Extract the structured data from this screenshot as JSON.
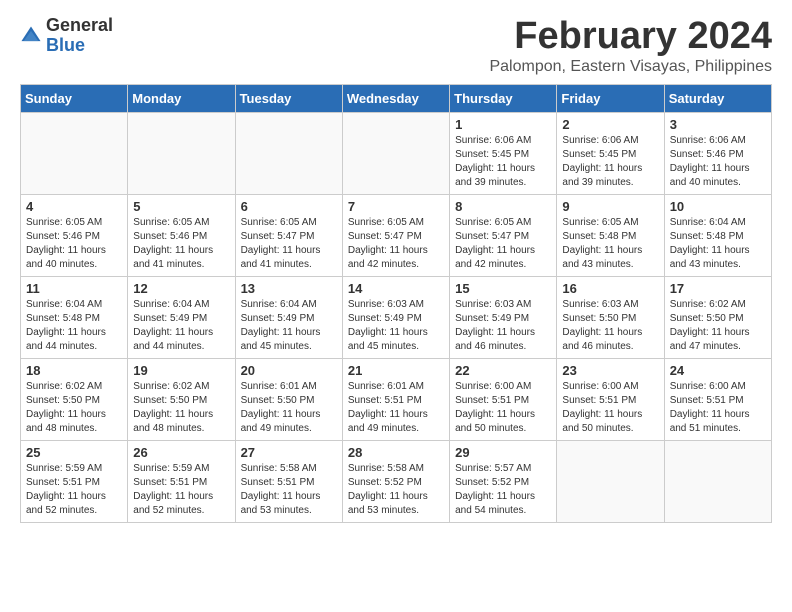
{
  "logo": {
    "general": "General",
    "blue": "Blue"
  },
  "header": {
    "month": "February 2024",
    "location": "Palompon, Eastern Visayas, Philippines"
  },
  "weekdays": [
    "Sunday",
    "Monday",
    "Tuesday",
    "Wednesday",
    "Thursday",
    "Friday",
    "Saturday"
  ],
  "weeks": [
    [
      {
        "day": "",
        "info": ""
      },
      {
        "day": "",
        "info": ""
      },
      {
        "day": "",
        "info": ""
      },
      {
        "day": "",
        "info": ""
      },
      {
        "day": "1",
        "info": "Sunrise: 6:06 AM\nSunset: 5:45 PM\nDaylight: 11 hours\nand 39 minutes."
      },
      {
        "day": "2",
        "info": "Sunrise: 6:06 AM\nSunset: 5:45 PM\nDaylight: 11 hours\nand 39 minutes."
      },
      {
        "day": "3",
        "info": "Sunrise: 6:06 AM\nSunset: 5:46 PM\nDaylight: 11 hours\nand 40 minutes."
      }
    ],
    [
      {
        "day": "4",
        "info": "Sunrise: 6:05 AM\nSunset: 5:46 PM\nDaylight: 11 hours\nand 40 minutes."
      },
      {
        "day": "5",
        "info": "Sunrise: 6:05 AM\nSunset: 5:46 PM\nDaylight: 11 hours\nand 41 minutes."
      },
      {
        "day": "6",
        "info": "Sunrise: 6:05 AM\nSunset: 5:47 PM\nDaylight: 11 hours\nand 41 minutes."
      },
      {
        "day": "7",
        "info": "Sunrise: 6:05 AM\nSunset: 5:47 PM\nDaylight: 11 hours\nand 42 minutes."
      },
      {
        "day": "8",
        "info": "Sunrise: 6:05 AM\nSunset: 5:47 PM\nDaylight: 11 hours\nand 42 minutes."
      },
      {
        "day": "9",
        "info": "Sunrise: 6:05 AM\nSunset: 5:48 PM\nDaylight: 11 hours\nand 43 minutes."
      },
      {
        "day": "10",
        "info": "Sunrise: 6:04 AM\nSunset: 5:48 PM\nDaylight: 11 hours\nand 43 minutes."
      }
    ],
    [
      {
        "day": "11",
        "info": "Sunrise: 6:04 AM\nSunset: 5:48 PM\nDaylight: 11 hours\nand 44 minutes."
      },
      {
        "day": "12",
        "info": "Sunrise: 6:04 AM\nSunset: 5:49 PM\nDaylight: 11 hours\nand 44 minutes."
      },
      {
        "day": "13",
        "info": "Sunrise: 6:04 AM\nSunset: 5:49 PM\nDaylight: 11 hours\nand 45 minutes."
      },
      {
        "day": "14",
        "info": "Sunrise: 6:03 AM\nSunset: 5:49 PM\nDaylight: 11 hours\nand 45 minutes."
      },
      {
        "day": "15",
        "info": "Sunrise: 6:03 AM\nSunset: 5:49 PM\nDaylight: 11 hours\nand 46 minutes."
      },
      {
        "day": "16",
        "info": "Sunrise: 6:03 AM\nSunset: 5:50 PM\nDaylight: 11 hours\nand 46 minutes."
      },
      {
        "day": "17",
        "info": "Sunrise: 6:02 AM\nSunset: 5:50 PM\nDaylight: 11 hours\nand 47 minutes."
      }
    ],
    [
      {
        "day": "18",
        "info": "Sunrise: 6:02 AM\nSunset: 5:50 PM\nDaylight: 11 hours\nand 48 minutes."
      },
      {
        "day": "19",
        "info": "Sunrise: 6:02 AM\nSunset: 5:50 PM\nDaylight: 11 hours\nand 48 minutes."
      },
      {
        "day": "20",
        "info": "Sunrise: 6:01 AM\nSunset: 5:50 PM\nDaylight: 11 hours\nand 49 minutes."
      },
      {
        "day": "21",
        "info": "Sunrise: 6:01 AM\nSunset: 5:51 PM\nDaylight: 11 hours\nand 49 minutes."
      },
      {
        "day": "22",
        "info": "Sunrise: 6:00 AM\nSunset: 5:51 PM\nDaylight: 11 hours\nand 50 minutes."
      },
      {
        "day": "23",
        "info": "Sunrise: 6:00 AM\nSunset: 5:51 PM\nDaylight: 11 hours\nand 50 minutes."
      },
      {
        "day": "24",
        "info": "Sunrise: 6:00 AM\nSunset: 5:51 PM\nDaylight: 11 hours\nand 51 minutes."
      }
    ],
    [
      {
        "day": "25",
        "info": "Sunrise: 5:59 AM\nSunset: 5:51 PM\nDaylight: 11 hours\nand 52 minutes."
      },
      {
        "day": "26",
        "info": "Sunrise: 5:59 AM\nSunset: 5:51 PM\nDaylight: 11 hours\nand 52 minutes."
      },
      {
        "day": "27",
        "info": "Sunrise: 5:58 AM\nSunset: 5:51 PM\nDaylight: 11 hours\nand 53 minutes."
      },
      {
        "day": "28",
        "info": "Sunrise: 5:58 AM\nSunset: 5:52 PM\nDaylight: 11 hours\nand 53 minutes."
      },
      {
        "day": "29",
        "info": "Sunrise: 5:57 AM\nSunset: 5:52 PM\nDaylight: 11 hours\nand 54 minutes."
      },
      {
        "day": "",
        "info": ""
      },
      {
        "day": "",
        "info": ""
      }
    ]
  ]
}
